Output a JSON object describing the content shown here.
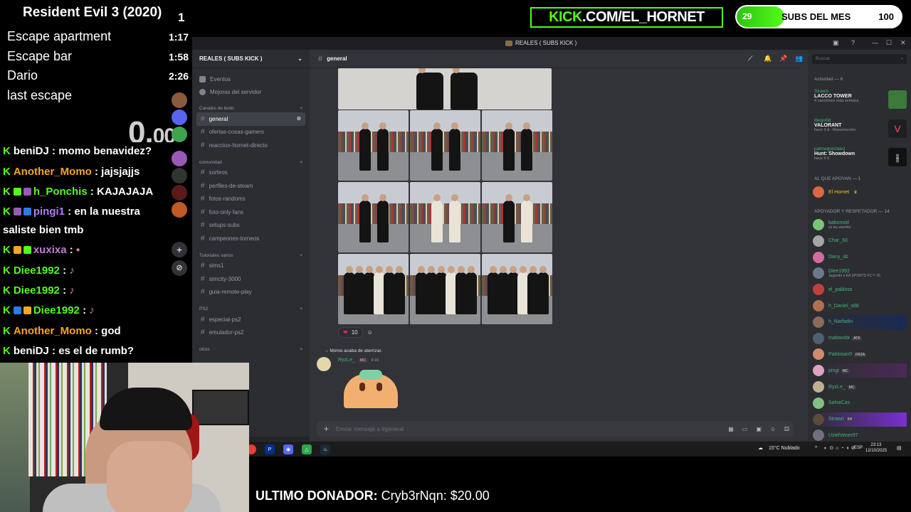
{
  "overlay": {
    "game_title": "Resident Evil 3 (2020)",
    "attempt_count": "1",
    "splits": [
      {
        "name": "Escape apartment",
        "time": "1:17"
      },
      {
        "name": "Escape bar",
        "time": "1:58"
      },
      {
        "name": "Dario",
        "time": "2:26"
      },
      {
        "name": "last escape",
        "time": ""
      }
    ],
    "timer_main": "0.",
    "timer_decimal": "00",
    "kick_prefix": "KICK",
    "kick_suffix": ".COM/EL_HORNET",
    "subs_current": "29",
    "subs_label": "SUBS DEL MES",
    "subs_goal": "100",
    "subs_progress": 0.29,
    "donor_label": "ULTIMO DONADOR:",
    "donor_value": "Cryb3rNqn: $20.00",
    "accent": "#53fc18"
  },
  "stream_chat": [
    {
      "user": "beniDJ",
      "text": " : momo benavidez?",
      "color": "#ffffff"
    },
    {
      "user": "Another_Momo",
      "text": " : jajsjajjs",
      "color": "#f5a623"
    },
    {
      "user": "h_Ponchis",
      "text": " : KAJAJAJA",
      "color": "#53fc18"
    },
    {
      "user": "pingi1",
      "text": " : en la nuestra",
      "color": "#b07cf5"
    },
    {
      "user": "",
      "text": "saliste bien tmb",
      "color": "#ffffff"
    },
    {
      "user": "xuxixa",
      "text": " : ",
      "color": "#c27bd8"
    },
    {
      "user": "Diee1992",
      "text": " : ",
      "color": "#53fc18"
    },
    {
      "user": "Diee1992",
      "text": " : ",
      "color": "#53fc18"
    },
    {
      "user": "Diee1992",
      "text": " : ",
      "color": "#53fc18"
    },
    {
      "user": "Another_Momo",
      "text": " : god",
      "color": "#f5a623"
    },
    {
      "user": "beniDJ",
      "text": " : es el de rumb?",
      "color": "#ffffff"
    }
  ],
  "discord": {
    "window_title": "REALES ( SUBS KICK )",
    "server_name": "REALES ( SUBS KICK )",
    "nav": [
      "Eventos",
      "Mejoras del servidor"
    ],
    "categories": [
      {
        "name": "Canales de texto",
        "channels": [
          "general",
          "ofertas-cosas-gamers",
          "reaccion-hornet-directo"
        ]
      },
      {
        "name": "comunidad",
        "channels": [
          "sorteos",
          "perfiles-de-steam",
          "fotos-randoms",
          "foto-only-fans",
          "setups-subs",
          "campeones-torneos"
        ]
      },
      {
        "name": "Tutoriales varios",
        "channels": [
          "sims1",
          "simcity-3000",
          "guia-remote-play"
        ]
      },
      {
        "name": "PS2",
        "channels": [
          "especial-ps2",
          "emulador-ps2"
        ]
      },
      {
        "name": "otros",
        "channels": []
      }
    ],
    "channel": "general",
    "search_placeholder": "Buscar",
    "reaction_count": "10",
    "reply_text": "Momo acaba de aterrizar.",
    "author": "RyzLe_",
    "author_badge": "MC",
    "author_time": "4:16",
    "input_placeholder": "Enviar mensaje a #general",
    "activity_header": "Actividad — 6",
    "activities": [
      {
        "user": "Strawn",
        "title": "LACCO TOWER",
        "detail": "4 canciones esta semana",
        "color": "#3c7a3c"
      },
      {
        "user": "diego0d",
        "title": "VALORANT",
        "detail": "hace 3 d · Resurrección",
        "color": "#1e1f22"
      },
      {
        "user": "palmegonzalez",
        "title": "Hunt: Showdown",
        "detail": "hace 5 d",
        "color": "#111111"
      }
    ],
    "group1_header": "AL QUE APOYAN — 1",
    "group1": [
      {
        "name": "El Hornet",
        "color": "#f0c419"
      }
    ],
    "group2_header": "APOYADOR Y RESPETADOR — 14",
    "members": [
      {
        "name": "babonoid",
        "sub": "es ley wachito",
        "tag": ""
      },
      {
        "name": "Char_93",
        "sub": "",
        "tag": ""
      },
      {
        "name": "Dany_sb",
        "sub": "",
        "tag": ""
      },
      {
        "name": "Diee1992",
        "sub": "Jugando a EA SPORTS FC™ 26",
        "tag": ""
      },
      {
        "name": "el_pabloss",
        "sub": "",
        "tag": ""
      },
      {
        "name": "h_Daniel_s88",
        "sub": "",
        "tag": ""
      },
      {
        "name": "h_Narfadin",
        "sub": "",
        "tag": ""
      },
      {
        "name": "matiassbr",
        "sub": "",
        "tag": "ATK"
      },
      {
        "name": "Pablosan9",
        "sub": "",
        "tag": "FRZA"
      },
      {
        "name": "pingi",
        "sub": "",
        "tag": "MC"
      },
      {
        "name": "RyzLe_",
        "sub": "",
        "tag": "MC"
      },
      {
        "name": "SalvaCas",
        "sub": "",
        "tag": ""
      },
      {
        "name": "Strawn",
        "sub": "",
        "tag": "6H"
      },
      {
        "name": "UzielVener97",
        "sub": "",
        "tag": ""
      }
    ]
  },
  "taskbar": {
    "weather": "15°C  Nublado",
    "lang": "ESP",
    "time": "23:13",
    "date": "12/10/2025"
  }
}
